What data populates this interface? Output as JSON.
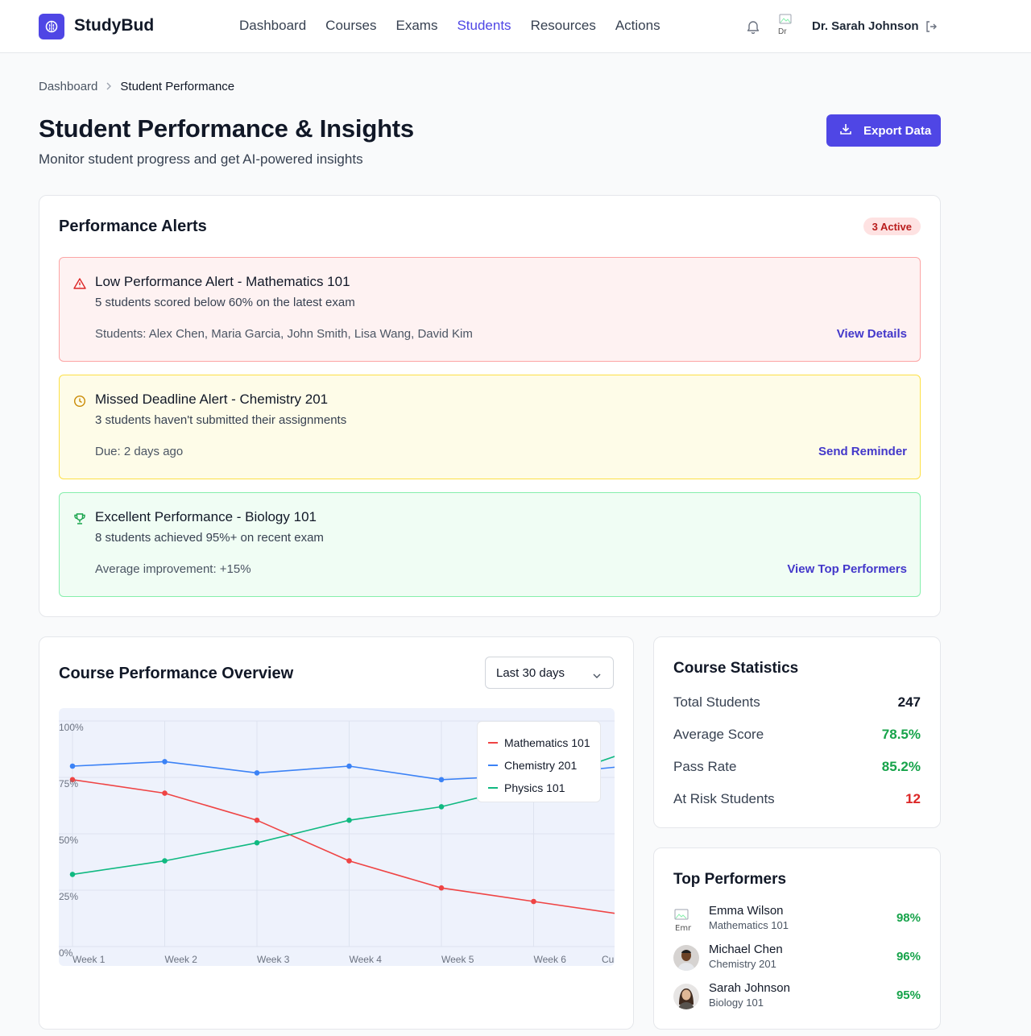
{
  "app": {
    "name": "StudyBud"
  },
  "nav": {
    "items": [
      {
        "label": "Dashboard"
      },
      {
        "label": "Courses"
      },
      {
        "label": "Exams"
      },
      {
        "label": "Students"
      },
      {
        "label": "Resources"
      },
      {
        "label": "Actions"
      }
    ],
    "active": "Students"
  },
  "user": {
    "name": "Dr. Sarah Johnson",
    "avatar_alt": "Dr"
  },
  "breadcrumb": {
    "root": "Dashboard",
    "current": "Student Performance"
  },
  "page": {
    "title": "Student Performance & Insights",
    "subtitle": "Monitor student progress and get AI-powered insights",
    "export_label": "Export Data"
  },
  "alerts": {
    "title": "Performance Alerts",
    "badge": "3 Active",
    "items": [
      {
        "icon": "warning-triangle-icon",
        "title": "Low Performance Alert - Mathematics 101",
        "desc": "5 students scored below 60% on the latest exam",
        "meta": "Students: Alex Chen, Maria Garcia, John Smith, Lisa Wang, David Kim",
        "action": "View Details"
      },
      {
        "icon": "clock-icon",
        "title": "Missed Deadline Alert - Chemistry 201",
        "desc": "3 students haven't submitted their assignments",
        "meta": "Due: 2 days ago",
        "action": "Send Reminder"
      },
      {
        "icon": "trophy-icon",
        "title": "Excellent Performance - Biology 101",
        "desc": "8 students achieved 95%+ on recent exam",
        "meta": "Average improvement: +15%",
        "action": "View Top Performers"
      }
    ]
  },
  "overview": {
    "title": "Course Performance Overview",
    "range": "Last 30 days"
  },
  "chart_data": {
    "type": "line",
    "categories": [
      "Week 1",
      "Week 2",
      "Week 3",
      "Week 4",
      "Week 5",
      "Week 6",
      "Current"
    ],
    "yticks": [
      "0%",
      "25%",
      "50%",
      "75%",
      "100%"
    ],
    "ylim": [
      0,
      100
    ],
    "grid": true,
    "legend_position": "top-right",
    "series": [
      {
        "name": "Mathematics 101",
        "color": "#ef4444",
        "values": [
          74,
          68,
          56,
          38,
          26,
          20,
          14
        ]
      },
      {
        "name": "Chemistry 201",
        "color": "#3b82f6",
        "values": [
          80,
          82,
          77,
          80,
          74,
          76,
          80
        ]
      },
      {
        "name": "Physics 101",
        "color": "#10b981",
        "values": [
          32,
          38,
          46,
          56,
          62,
          72,
          86
        ]
      }
    ]
  },
  "stats": {
    "title": "Course Statistics",
    "rows": [
      {
        "label": "Total Students",
        "value": "247",
        "color": "#111827"
      },
      {
        "label": "Average Score",
        "value": "78.5%",
        "color": "#16a34a"
      },
      {
        "label": "Pass Rate",
        "value": "85.2%",
        "color": "#16a34a"
      },
      {
        "label": "At Risk Students",
        "value": "12",
        "color": "#dc2626"
      }
    ]
  },
  "top_performers": {
    "title": "Top Performers",
    "items": [
      {
        "name": "Emma Wilson",
        "course": "Mathematics 101",
        "score": "98%"
      },
      {
        "name": "Michael Chen",
        "course": "Chemistry 201",
        "score": "96%"
      },
      {
        "name": "Sarah Johnson",
        "course": "Biology 101",
        "score": "95%"
      }
    ]
  }
}
